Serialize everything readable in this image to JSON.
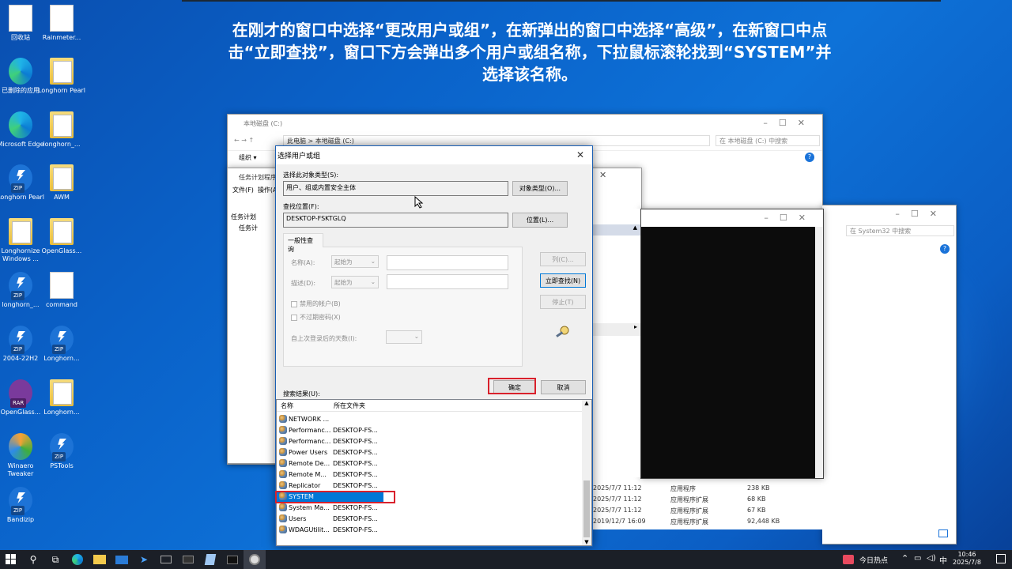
{
  "caption": {
    "line1": "在刚才的窗口中选择“更改用户或组”，在新弹出的窗口中选择“高级”，在新窗口中点",
    "line2": "击“立即查找”，窗口下方会弹出多个用户或组名称，下拉鼠标滚轮找到“SYSTEM”并",
    "line3": "选择该名称。"
  },
  "desktop": {
    "icons": [
      {
        "label": "回收站",
        "icon": "recycle-bin-icon"
      },
      {
        "label": "Rainmeter...",
        "icon": "rainmeter-icon"
      },
      {
        "label": "已删除的应用",
        "icon": "edge-icon"
      },
      {
        "label": "Longhorn Pearl",
        "icon": "folder-icon"
      },
      {
        "label": "Microsoft Edge",
        "icon": "edge-icon"
      },
      {
        "label": "longhorn_...",
        "icon": "folder-icon"
      },
      {
        "label": "Longhorn Pearl",
        "icon": "zip-icon"
      },
      {
        "label": "AWM",
        "icon": "folder-icon"
      },
      {
        "label": "Longhornize Windows ...",
        "icon": "folder-icon"
      },
      {
        "label": "OpenGlass...",
        "icon": "folder-icon"
      },
      {
        "label": "longhorn_...",
        "icon": "zip-icon"
      },
      {
        "label": "command",
        "icon": "document-icon"
      },
      {
        "label": "2004-22H2",
        "icon": "zip-icon"
      },
      {
        "label": "Longhorn...",
        "icon": "zip-icon"
      },
      {
        "label": "OpenGlass...",
        "icon": "rar-icon"
      },
      {
        "label": "Longhorn...",
        "icon": "folder-icon"
      },
      {
        "label": "Winaero Tweaker",
        "icon": "winaero-icon"
      },
      {
        "label": "PSTools",
        "icon": "zip-icon"
      },
      {
        "label": "Bandizip",
        "icon": "zip-icon"
      }
    ]
  },
  "explorer1": {
    "title": "本地磁盘 (C:)",
    "breadcrumb1": "此电脑",
    "breadcrumb2": "本地磁盘 (C:)",
    "search_placeholder": "在 本地磁盘 (C:) 中搜索",
    "org": "组织 ▾"
  },
  "taskwin": {
    "title": "任务计划程序",
    "menu_file": "文件(F)",
    "menu_op": "操作(A)",
    "tree1": "任务计划",
    "tree2": "任务计"
  },
  "explorer2": {
    "search_placeholder": "在 System32 中搜索"
  },
  "files": [
    {
      "date": "2025/7/7 11:12",
      "type": "应用程序",
      "size": "238 KB"
    },
    {
      "date": "2025/7/7 11:12",
      "type": "应用程序扩展",
      "size": "68 KB"
    },
    {
      "date": "2025/7/7 11:12",
      "type": "应用程序扩展",
      "size": "67 KB"
    },
    {
      "date": "2019/12/7 16:09",
      "type": "应用程序扩展",
      "size": "92,448 KB"
    }
  ],
  "dialog": {
    "title": "选择用户或组",
    "obj_type_label": "选择此对象类型(S):",
    "obj_type_value": "用户、组或内置安全主体",
    "obj_type_button": "对象类型(O)...",
    "location_label": "查找位置(F):",
    "location_value": "DESKTOP-FSKTGLQ",
    "location_button": "位置(L)...",
    "tab": "一般性查询",
    "name_label": "名称(A):",
    "desc_label": "描述(D):",
    "starts_with": "起始为",
    "disabled_accounts": "禁用的帐户(B)",
    "no_expire": "不过期密码(X)",
    "days_label": "自上次登录后的天数(I):",
    "columns_button": "列(C)...",
    "find_now_button": "立即查找(N)",
    "stop_button": "停止(T)",
    "ok_button": "确定",
    "cancel_button": "取消",
    "results_label": "搜索结果(U):",
    "col_name": "名称",
    "col_folder": "所在文件夹",
    "results": [
      {
        "name": "NETWORK ...",
        "folder": ""
      },
      {
        "name": "Performanc...",
        "folder": "DESKTOP-FS..."
      },
      {
        "name": "Performanc...",
        "folder": "DESKTOP-FS..."
      },
      {
        "name": "Power Users",
        "folder": "DESKTOP-FS..."
      },
      {
        "name": "Remote De...",
        "folder": "DESKTOP-FS..."
      },
      {
        "name": "Remote M...",
        "folder": "DESKTOP-FS..."
      },
      {
        "name": "Replicator",
        "folder": "DESKTOP-FS..."
      },
      {
        "name": "SYSTEM",
        "folder": ""
      },
      {
        "name": "System Ma...",
        "folder": "DESKTOP-FS..."
      },
      {
        "name": "Users",
        "folder": "DESKTOP-FS..."
      },
      {
        "name": "WDAGUtilit...",
        "folder": "DESKTOP-FS..."
      }
    ],
    "selected": "SYSTEM"
  },
  "taskbar": {
    "news": "今日热点",
    "ime": "中",
    "time": "10:46",
    "date": "2025/7/8"
  }
}
